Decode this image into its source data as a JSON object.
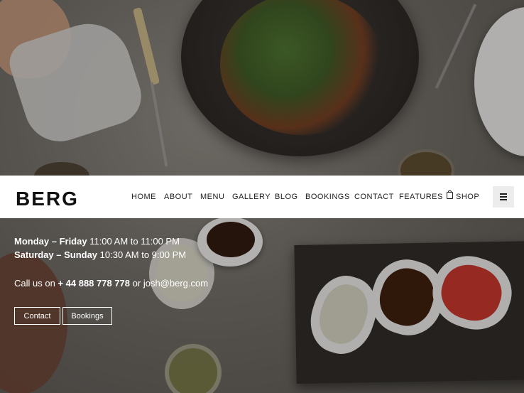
{
  "brand": {
    "logo": "BERG"
  },
  "nav": {
    "items": [
      {
        "label": "HOME"
      },
      {
        "label": "ABOUT"
      },
      {
        "label": "MENU"
      },
      {
        "label": "GALLERY"
      },
      {
        "label": "BLOG"
      },
      {
        "label": "BOOKINGS"
      },
      {
        "label": "CONTACT"
      },
      {
        "label": "FEATURES"
      },
      {
        "label": "SHOP",
        "icon": "shopping-bag-icon"
      }
    ],
    "menu_toggle_icon": "hamburger-icon"
  },
  "hero": {
    "hours": [
      {
        "days": "Monday – Friday",
        "time": "11:00 AM to 11:00 PM"
      },
      {
        "days": "Saturday – Sunday",
        "time": "10:30 AM to 9:00 PM"
      }
    ],
    "call": {
      "prefix": "Call us on",
      "phone": "+ 44 888 778 778",
      "joiner": "or",
      "email": "josh@berg.com"
    },
    "buttons": [
      {
        "label": "Contact"
      },
      {
        "label": "Bookings"
      }
    ]
  },
  "colors": {
    "navbar_bg": "#ffffff",
    "text_dark": "#111111",
    "hero_text": "#ffffff"
  }
}
